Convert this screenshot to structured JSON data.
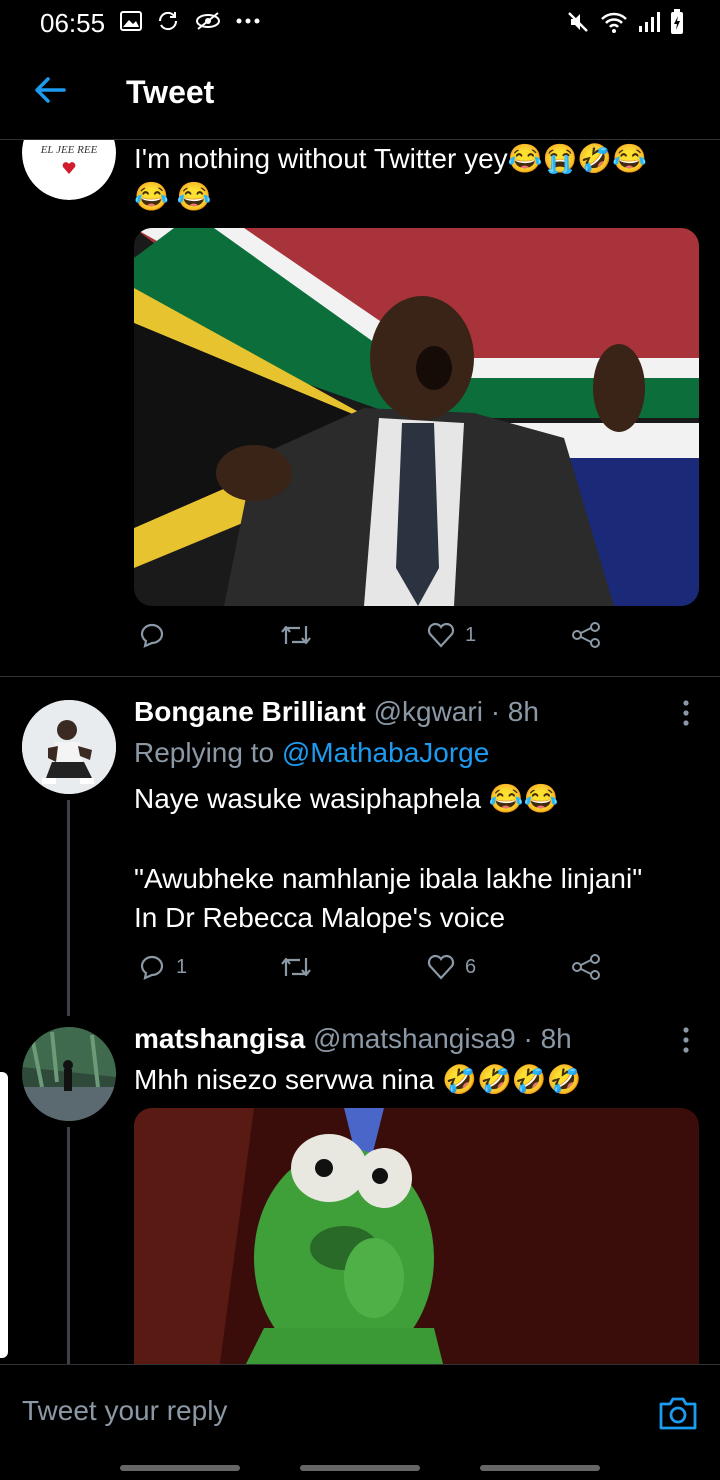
{
  "status_bar": {
    "time": "06:55",
    "left_icons": [
      "gallery-icon",
      "sync-icon",
      "eye-off-icon",
      "more-dots-icon"
    ],
    "right_icons": [
      "mute-icon",
      "wifi-icon",
      "signal-icon",
      "battery-icon"
    ]
  },
  "header": {
    "title": "Tweet",
    "back_icon": "back-arrow-icon"
  },
  "tweet_top": {
    "avatar_text": "EL JEE REE",
    "text": "I'm nothing without Twitter yey😂😭🤣😂",
    "text_line2": "😂 😂",
    "image_alt": "laughing man in suit in front of South African flag",
    "actions": {
      "reply_count": "",
      "retweet_count": "",
      "like_count": "1"
    }
  },
  "tweet_reply1": {
    "name": "Bongane Brilliant",
    "handle": "@kgwari · 8h",
    "replying_prefix": "Replying to ",
    "replying_to": "@MathabaJorge",
    "line1": "Naye wasuke wasiphaphela 😂😂",
    "line2": "\"Awubheke namhlanje ibala lakhe linjani\"",
    "line3": "In Dr Rebecca Malope's voice",
    "actions": {
      "reply_count": "1",
      "retweet_count": "",
      "like_count": "6"
    }
  },
  "tweet_reply2": {
    "name": "matshangisa",
    "handle": "@matshangisa9 · 8h",
    "text": "Mhh nisezo servwa nina 🤣🤣🤣🤣",
    "image_alt": "Kermit the frog biting nails"
  },
  "reply_bar": {
    "placeholder": "Tweet your reply",
    "camera_icon": "camera-icon"
  },
  "colors": {
    "accent": "#1d9bf0",
    "muted": "#8b98a5",
    "divider": "#2f3336",
    "background": "#000000"
  }
}
